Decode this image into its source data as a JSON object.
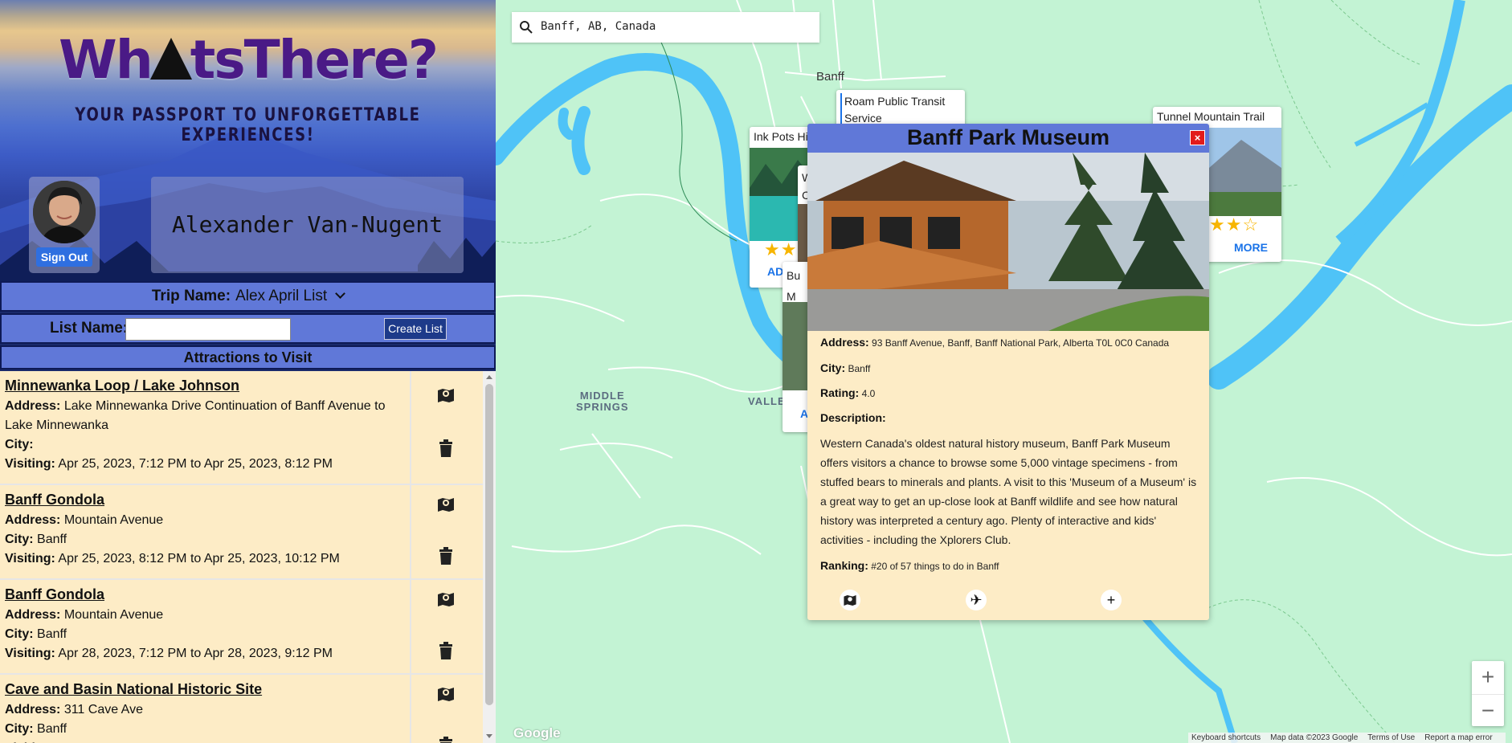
{
  "app": {
    "logo_text_before": "Wh",
    "logo_text_after": "tsThere?",
    "tagline": "YOUR PASSPORT TO UNFORGETTABLE EXPERIENCES!",
    "user_name": "Alexander Van-Nugent",
    "sign_out_label": "Sign Out"
  },
  "trip": {
    "label": "Trip Name:",
    "value": "Alex April List"
  },
  "list_form": {
    "label": "List Name:",
    "input_value": "",
    "create_label": "Create List"
  },
  "attractions": {
    "heading": "Attractions to Visit",
    "address_label": "Address:",
    "city_label": "City:",
    "visiting_label": "Visiting:",
    "items": [
      {
        "title": "Minnewanka Loop / Lake Johnson",
        "address": "Lake Minnewanka Drive Continuation of Banff Avenue to Lake Minnewanka",
        "city": "",
        "visiting": "Apr 25, 2023, 7:12 PM to Apr 25, 2023, 8:12 PM"
      },
      {
        "title": "Banff Gondola",
        "address": "Mountain Avenue",
        "city": "Banff",
        "visiting": "Apr 25, 2023, 8:12 PM to Apr 25, 2023, 10:12 PM"
      },
      {
        "title": "Banff Gondola",
        "address": "Mountain Avenue",
        "city": "Banff",
        "visiting": "Apr 28, 2023, 7:12 PM to Apr 28, 2023, 9:12 PM"
      },
      {
        "title": "Cave and Basin National Historic Site",
        "address": "311 Cave Ave",
        "city": "Banff",
        "visiting": ""
      }
    ]
  },
  "map": {
    "search_value": "Banff, AB, Canada",
    "town_label": "Banff",
    "area_label_1_line1": "MIDDLE",
    "area_label_1_line2": "SPRINGS",
    "area_label_2": "VALLE",
    "cards": {
      "ink_pots": "Ink Pots Hi",
      "roam_line1": "Roam Public Transit",
      "roam_line2": "Service",
      "tunnel": "Tunnel Mountain Trail",
      "w_line1": "W",
      "w_line2": "C",
      "bu_line1": "Bu",
      "bu_line2": "M",
      "ad_partial": "AD",
      "a_partial": "A",
      "more_label": "MORE"
    },
    "ratings": {
      "tunnel": 3.5,
      "ink_pots": 2
    },
    "zoom_in": "+",
    "zoom_out": "−",
    "google_label": "Google",
    "attribution": [
      "Keyboard shortcuts",
      "Map data ©2023 Google",
      "Terms of Use",
      "Report a map error"
    ]
  },
  "popup": {
    "title": "Banff Park Museum",
    "close": "×",
    "address_label": "Address:",
    "address": "93 Banff Avenue, Banff, Banff National Park, Alberta T0L 0C0 Canada",
    "city_label": "City:",
    "city": "Banff",
    "rating_label": "Rating:",
    "rating": "4.0",
    "description_label": "Description:",
    "description": "Western Canada's oldest natural history museum, Banff Park Museum offers visitors a chance to browse some 5,000 vintage specimens - from stuffed bears to minerals and plants. A visit to this 'Museum of a Museum' is a great way to get an up-close look at Banff wildlife and see how natural history was interpreted a century ago. Plenty of interactive and kids' activities - including the Xplorers Club.",
    "ranking_label": "Ranking:",
    "ranking": "#20 of 57 things to do in Banff",
    "add_label": "+"
  },
  "colors": {
    "panel_bar": "#6078d8",
    "list_item_bg": "#fdecc6",
    "map_bg": "#c3f3d4",
    "river": "#4fc3f7",
    "close_button": "#e21b1b",
    "sign_out": "#2f6fe0"
  },
  "icons": {
    "map": "folded-map-pin-icon",
    "trash": "trash-icon",
    "flight": "airplane-icon",
    "search": "search-icon",
    "dropdown": "chevron-down-icon"
  }
}
